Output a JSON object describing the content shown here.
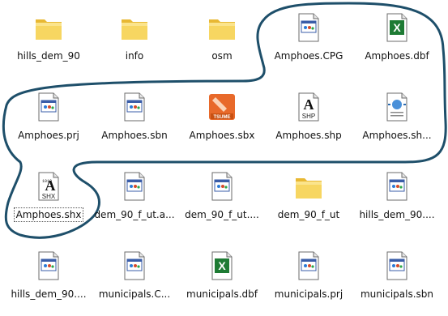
{
  "files": [
    {
      "label": "hills_dem_90",
      "icon": "folder-icon"
    },
    {
      "label": "info",
      "icon": "folder-icon"
    },
    {
      "label": "osm",
      "icon": "folder-icon"
    },
    {
      "label": "Amphoes.CPG",
      "icon": "generic-file-icon"
    },
    {
      "label": "Amphoes.dbf",
      "icon": "excel-file-icon"
    },
    {
      "label": "Amphoes.prj",
      "icon": "generic-file-icon"
    },
    {
      "label": "Amphoes.sbn",
      "icon": "generic-file-icon"
    },
    {
      "label": "Amphoes.sbx",
      "icon": "tsume-file-icon",
      "badge": "TSUME"
    },
    {
      "label": "Amphoes.shp",
      "icon": "shp-file-icon",
      "badge": "SHP"
    },
    {
      "label": "Amphoes.sh...",
      "icon": "xml-file-icon"
    },
    {
      "label": "Amphoes.shx",
      "icon": "shx-file-icon",
      "badge": "SHX",
      "selected": true
    },
    {
      "label": "dem_90_f_ut.a...",
      "icon": "generic-file-icon"
    },
    {
      "label": "dem_90_f_ut....",
      "icon": "generic-file-icon"
    },
    {
      "label": "dem_90_f_ut",
      "icon": "folder-icon"
    },
    {
      "label": "hills_dem_90....",
      "icon": "generic-file-icon"
    },
    {
      "label": "hills_dem_90....",
      "icon": "generic-file-icon"
    },
    {
      "label": "municipals.C...",
      "icon": "generic-file-icon"
    },
    {
      "label": "municipals.dbf",
      "icon": "excel-file-icon"
    },
    {
      "label": "municipals.prj",
      "icon": "generic-file-icon"
    },
    {
      "label": "municipals.sbn",
      "icon": "generic-file-icon"
    }
  ],
  "colors": {
    "annotation": "#1e4f6a",
    "folder": "#f7d661",
    "excel": "#1e7b34",
    "tsume": "#e8692a"
  }
}
